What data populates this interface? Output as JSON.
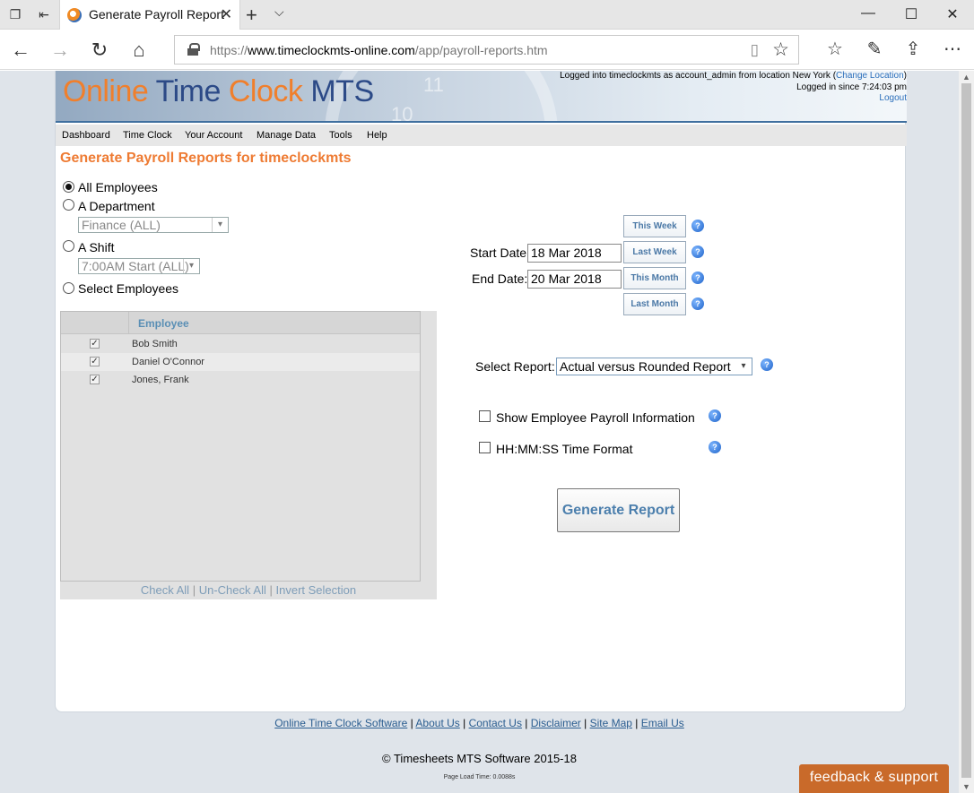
{
  "browser": {
    "tab_title": "Generate Payroll Report",
    "url_prefix": "https://",
    "url_domain": "www.timeclockmts-online.com",
    "url_path": "/app/payroll-reports.htm"
  },
  "header": {
    "logo": {
      "part1": "Online",
      "part2": "Time",
      "part3": "Clock",
      "part4": "MTS"
    },
    "clock_numbers": {
      "eleven": "11",
      "ten": "10"
    },
    "login_line1_prefix": "Logged into timeclockmts as account_admin from location New York (",
    "change_location": "Change Location",
    "login_line1_suffix": ")",
    "login_line2": "Logged in since 7:24:03 pm",
    "logout": "Logout"
  },
  "menu": {
    "items": [
      "Dashboard",
      "Time Clock",
      "Your Account",
      "Manage Data",
      "Tools",
      "Help"
    ]
  },
  "page": {
    "title": "Generate Payroll Reports for timeclockmts"
  },
  "selection": {
    "all_employees": "All Employees",
    "a_department": "A Department",
    "department_value": "Finance (ALL)",
    "a_shift": "A Shift",
    "shift_value": "7:00AM Start (ALL)",
    "select_employees": "Select Employees"
  },
  "employee_grid": {
    "header": "Employee",
    "rows": [
      "Bob Smith",
      "Daniel O'Connor",
      "Jones, Frank"
    ],
    "check_mark": "✓",
    "footer": {
      "check_all": "Check All",
      "uncheck_all": "Un-Check All",
      "invert": "Invert Selection",
      "separator": "|"
    }
  },
  "dates": {
    "start_label": "Start Date:",
    "start_value": "18 Mar 2018",
    "end_label": "End Date:",
    "end_value": "20 Mar 2018",
    "quick_buttons": [
      "This Week",
      "Last Week",
      "This Month",
      "Last Month"
    ]
  },
  "report": {
    "label": "Select Report:",
    "value": "Actual versus Rounded Report",
    "show_payroll_info": "Show Employee Payroll Information",
    "hhmmss_format": "HH:MM:SS Time Format",
    "generate_button": "Generate Report"
  },
  "footer": {
    "links": [
      "Online Time Clock Software",
      "About Us",
      "Contact Us",
      "Disclaimer",
      "Site Map",
      "Email Us"
    ],
    "separator": "|",
    "copyright": "© Timesheets MTS Software 2015-18",
    "load_time": "Page Load Time: 0.0088s",
    "feedback": "feedback & support"
  },
  "icons": {
    "help": "?",
    "select_arrow": "▾",
    "tab_close": "✕",
    "new_tab": "+",
    "tab_menu": "⌵",
    "back": "←",
    "forward": "→",
    "refresh": "↻",
    "home": "⌂",
    "reading_view": "▯",
    "favorite": "☆",
    "favorites_hub": "☆",
    "notes": "✎",
    "share": "⇪",
    "more": "⋯",
    "minimize": "—",
    "maximize": "☐",
    "close": "✕",
    "scroll_up": "▲",
    "scroll_down": "▼"
  },
  "colors": {
    "title_orange": "#ee7b33",
    "link_blue": "#2a5d90",
    "feedback_bg": "#c96a2a"
  }
}
